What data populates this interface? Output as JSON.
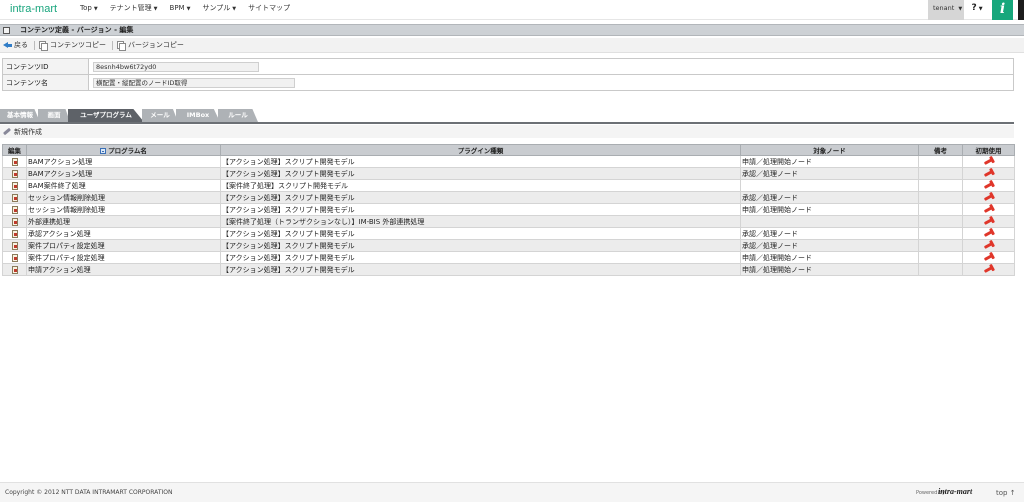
{
  "header": {
    "logo": "intra-mart",
    "nav": [
      "Top",
      "テナント管理",
      "BPM",
      "サンプル",
      "サイトマップ"
    ],
    "tenant": "tenant",
    "help": "?",
    "info_icon": "i"
  },
  "page": {
    "title": "コンテンツ定義 - バージョン - 編集"
  },
  "toolbar": {
    "back": "戻る",
    "content_copy": "コンテンツコピー",
    "version_copy": "バージョンコピー"
  },
  "info": {
    "content_id_label": "コンテンツID",
    "content_id_value": "8esnh4bw6t72yd0",
    "content_name_label": "コンテンツ名",
    "content_name_value": "横配置・縦配置のノードID取得"
  },
  "tabs": [
    "基本情報",
    "画面",
    "ユーザプログラム",
    "メール",
    "IMBox",
    "ルール"
  ],
  "active_tab": 2,
  "subbar": {
    "new_label": "新規作成"
  },
  "table": {
    "headers": [
      "編集",
      "プログラム名",
      "プラグイン種類",
      "対象ノード",
      "備考",
      "初期使用"
    ],
    "rows": [
      {
        "name": "BAMアクション処理",
        "plugin": "【アクション処理】スクリプト開発モデル",
        "node": "申請／処理開始ノード",
        "note": ""
      },
      {
        "name": "BAMアクション処理",
        "plugin": "【アクション処理】スクリプト開発モデル",
        "node": "承認／処理ノード",
        "note": ""
      },
      {
        "name": "BAM案件終了処理",
        "plugin": "【案件終了処理】スクリプト開発モデル",
        "node": "",
        "note": ""
      },
      {
        "name": "セッション情報削除処理",
        "plugin": "【アクション処理】スクリプト開発モデル",
        "node": "承認／処理ノード",
        "note": ""
      },
      {
        "name": "セッション情報削除処理",
        "plugin": "【アクション処理】スクリプト開発モデル",
        "node": "申請／処理開始ノード",
        "note": ""
      },
      {
        "name": "外部連携処理",
        "plugin": "【案件終了処理（トランザクションなし）】IM-BIS 外部連携処理",
        "node": "",
        "note": ""
      },
      {
        "name": "承認アクション処理",
        "plugin": "【アクション処理】スクリプト開発モデル",
        "node": "承認／処理ノード",
        "note": ""
      },
      {
        "name": "案件プロパティ設定処理",
        "plugin": "【アクション処理】スクリプト開発モデル",
        "node": "承認／処理ノード",
        "note": ""
      },
      {
        "name": "案件プロパティ設定処理",
        "plugin": "【アクション処理】スクリプト開発モデル",
        "node": "申請／処理開始ノード",
        "note": ""
      },
      {
        "name": "申請アクション処理",
        "plugin": "【アクション処理】スクリプト開発モデル",
        "node": "申請／処理開始ノード",
        "note": ""
      }
    ]
  },
  "footer": {
    "copyright": "Copyright © 2012 NTT DATA INTRAMART CORPORATION",
    "powered_by": "Powered by",
    "brand": "intra-mart",
    "top_link": "top ↑"
  },
  "colors": {
    "brand_green": "#17a77c",
    "active_tab": "#5e6268",
    "inactive_tab": "#aeb2b6",
    "pin_red": "#e0362a"
  },
  "icons": {
    "back": "arrow-left-icon",
    "copy": "copy-icon",
    "new": "pencil-icon",
    "edit": "edit-icon",
    "initial_use": "pin-icon",
    "sort": "sort-icon"
  }
}
